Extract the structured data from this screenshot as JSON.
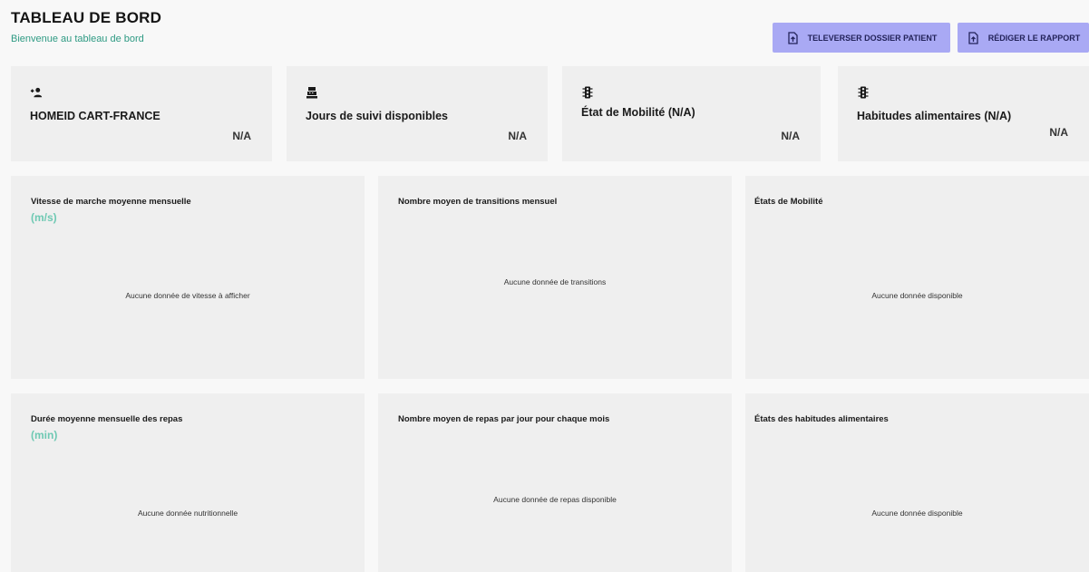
{
  "header": {
    "title": "TABLEAU DE BORD",
    "subtitle": "Bienvenue au tableau de bord"
  },
  "actions": {
    "upload_label": "TELEVERSER DOSSIER PATIENT",
    "report_label": "RÉDIGER LE RAPPORT"
  },
  "stats": [
    {
      "label": "HOMEID CART-FRANCE",
      "value": "N/A",
      "icon": "add-person-icon"
    },
    {
      "label": "Jours de suivi disponibles",
      "value": "N/A",
      "icon": "cash-register-icon"
    },
    {
      "label": "État de Mobilité (N/A)",
      "value": "N/A",
      "icon": "traffic-light-icon"
    },
    {
      "label": "Habitudes alimentaires (N/A)",
      "value": "N/A",
      "icon": "traffic-light-icon"
    }
  ],
  "charts": {
    "walk_speed": {
      "title": "Vitesse de marche moyenne mensuelle",
      "unit": "(m/s)",
      "empty": "Aucune donnée de vitesse à afficher"
    },
    "transitions": {
      "title": "Nombre moyen de transitions mensuel",
      "empty": "Aucune donnée de transitions"
    },
    "mobility_states": {
      "title": "États de Mobilité",
      "empty": "Aucune donnée disponible"
    },
    "meal_duration": {
      "title": "Durée moyenne mensuelle des repas",
      "unit": "(min)",
      "empty": "Aucune donnée nutritionnelle"
    },
    "meals_per_day": {
      "title": "Nombre moyen de repas par jour pour chaque mois",
      "empty": "Aucune donnée de repas disponible"
    },
    "eating_states": {
      "title": "États des habitudes alimentaires",
      "empty": "Aucune donnée disponible"
    }
  },
  "colors": {
    "button_bg": "#a9a9f4",
    "card_bg": "#efefef",
    "unit_text": "#6ec9b3",
    "subtitle_text": "#2e9a83"
  }
}
